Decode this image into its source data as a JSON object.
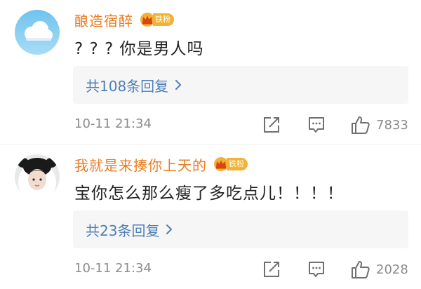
{
  "comments": [
    {
      "username": "酿造宿醉",
      "badge": "铁粉",
      "avatar": "cloud-avatar",
      "text": "? ? ? 你是男人吗",
      "reply_label": "共108条回复",
      "timestamp": "10-11 21:34",
      "likes": "7833"
    },
    {
      "username": "我就是来揍你上天的",
      "badge": "铁粉",
      "avatar": "panda-hood-avatar",
      "text": "宝你怎么那么瘦了多吃点儿！！！！",
      "reply_label": "共23条回复",
      "timestamp": "10-11 21:34",
      "likes": "2028"
    }
  ],
  "colors": {
    "username": "#ea7c20",
    "reply_link": "#4e7fb8",
    "meta_text": "#8c8c8c",
    "reply_bg": "#f6f6f6",
    "badge": "#f2b233"
  },
  "icons": [
    "crown-icon",
    "chevron-right-icon",
    "forward-icon",
    "comment-icon",
    "like-icon"
  ]
}
